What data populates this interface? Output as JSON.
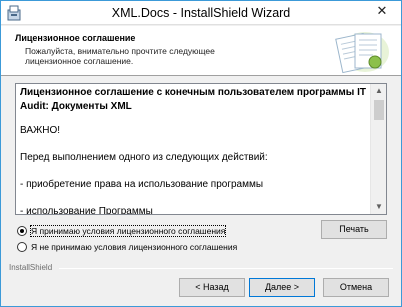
{
  "window": {
    "title": "XML.Docs - InstallShield Wizard",
    "close_glyph": "✕"
  },
  "header": {
    "title": "Лицензионное соглашение",
    "subtitle": "Пожалуйста, внимательно прочтите следующее лицензионное соглашение."
  },
  "license": {
    "heading": "Лицензионное соглашение с конечным пользователем программы IT Audit: Документы XML",
    "paragraphs": [
      "ВАЖНО!",
      "Перед выполнением одного из следующих действий:",
      "- приобретение права на использование программы",
      "- использование Программы"
    ]
  },
  "options": {
    "accept_label": "Я принимаю условия лицензионного соглашения",
    "decline_label": "Я не принимаю условия лицензионного соглашения",
    "selected": "accept"
  },
  "buttons": {
    "print": "Печать",
    "back": "< Назад",
    "next": "Далее >",
    "cancel": "Отмена"
  },
  "footer": {
    "brand": "InstallShield"
  }
}
